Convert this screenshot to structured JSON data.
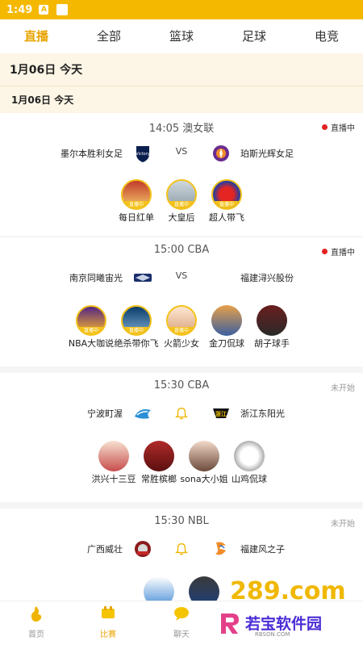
{
  "status_bar": {
    "time": "1:49",
    "indicator": "A"
  },
  "tabs": [
    {
      "label": "直播",
      "active": true
    },
    {
      "label": "全部",
      "active": false
    },
    {
      "label": "篮球",
      "active": false
    },
    {
      "label": "足球",
      "active": false
    },
    {
      "label": "电竞",
      "active": false
    }
  ],
  "date_header": "1月06日  今天",
  "date_subheader": "1月06日  今天",
  "matches": [
    {
      "time_league": "14:05  澳女联",
      "status": "直播中",
      "home": "墨尔本胜利女足",
      "mid": "VS",
      "away": "珀斯光辉女足",
      "anchors": [
        {
          "name": "每日红单",
          "live": "直播中"
        },
        {
          "name": "大皇后",
          "live": "直播中"
        },
        {
          "name": "超人带飞",
          "live": "直播中"
        }
      ]
    },
    {
      "time_league": "15:00  CBA",
      "status": "直播中",
      "home": "南京同曦宙光",
      "mid": "VS",
      "away": "福建浔兴股份",
      "anchors": [
        {
          "name": "NBA大咖说",
          "live": "直播中"
        },
        {
          "name": "绝杀带你飞",
          "live": "直播中"
        },
        {
          "name": "火箭少女",
          "live": "直播中"
        },
        {
          "name": "金刀侃球",
          "live": ""
        },
        {
          "name": "胡子球手",
          "live": ""
        }
      ]
    },
    {
      "time_league": "15:30  CBA",
      "status": "未开始",
      "home": "宁波町渥",
      "mid": "bell",
      "away": "浙江东阳光",
      "anchors": [
        {
          "name": "洪兴十三豆",
          "live": ""
        },
        {
          "name": "常胜槟榔",
          "live": ""
        },
        {
          "name": "sona大小姐",
          "live": ""
        },
        {
          "name": "山鸡侃球",
          "live": ""
        }
      ]
    },
    {
      "time_league": "15:30  NBL",
      "status": "未开始",
      "home": "广西威壮",
      "mid": "bell",
      "away": "福建风之子",
      "anchors": []
    }
  ],
  "bottom_nav": [
    {
      "label": "首页",
      "icon": "home-icon",
      "active": false
    },
    {
      "label": "比赛",
      "icon": "match-icon",
      "active": true
    },
    {
      "label": "聊天",
      "icon": "chat-icon",
      "active": false
    }
  ],
  "watermark": {
    "number": "289.com",
    "brand": "若宝软件园",
    "url": "RBSON.COM"
  },
  "colors": {
    "accent": "#f5b800",
    "live_dot": "#e32222",
    "date_bg": "#fdf6e6"
  }
}
